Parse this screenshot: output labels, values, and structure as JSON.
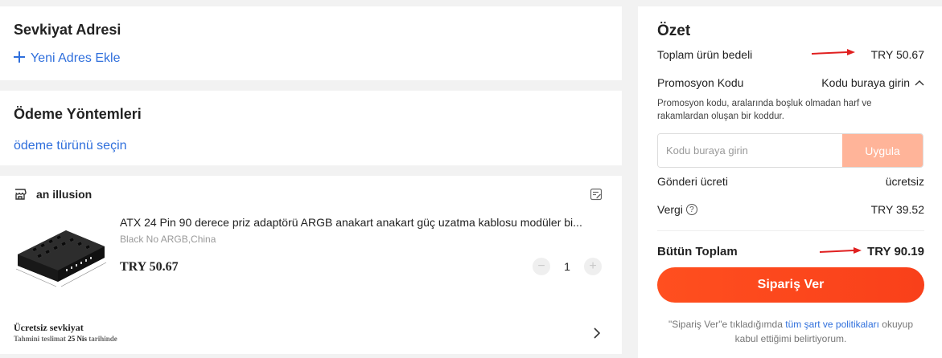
{
  "shipping": {
    "title": "Sevkiyat Adresi",
    "add_address_label": "Yeni Adres Ekle"
  },
  "payment": {
    "title": "Ödeme Yöntemleri",
    "select_label": "ödeme türünü seçin"
  },
  "item_card": {
    "store_name": "an illusion",
    "product": {
      "title": "ATX 24 Pin 90 derece priz adaptörü ARGB anakart anakart güç  uzatma kablosu modüler bi...",
      "variant": "Black No ARGB,China",
      "price": "TRY 50.67",
      "quantity": "1"
    },
    "shipping_free_label": "Ücretsiz sevkiyat",
    "delivery_prefix": "Tahmini teslimat",
    "delivery_date": "25 Nis",
    "delivery_suffix": "tarihinde"
  },
  "summary": {
    "title": "Özet",
    "subtotal_label": "Toplam ürün bedeli",
    "subtotal_value": "TRY 50.67",
    "promo_label": "Promosyon Kodu",
    "promo_toggle": "Kodu buraya girin",
    "promo_help": "Promosyon kodu, aralarında boşluk olmadan harf ve rakamlardan oluşan bir koddur.",
    "promo_placeholder": "Kodu buraya girin",
    "apply_label": "Uygula",
    "shipping_label": "Gönderi ücreti",
    "shipping_value": "ücretsiz",
    "tax_label": "Vergi",
    "tax_value": "TRY 39.52",
    "total_label": "Bütün Toplam",
    "total_value": "TRY 90.19",
    "order_button": "Sipariş Ver",
    "terms_prefix": "\"Sipariş Ver\"e tıkladığımda ",
    "terms_link": "tüm şart ve politikaları",
    "terms_suffix": " okuyup kabul ettiğimi belirtiyorum."
  },
  "colors": {
    "link": "#2f6fdc",
    "order_button": "#ff4f1f",
    "apply_button": "#ffb499",
    "annotation_arrow": "#e02020"
  }
}
